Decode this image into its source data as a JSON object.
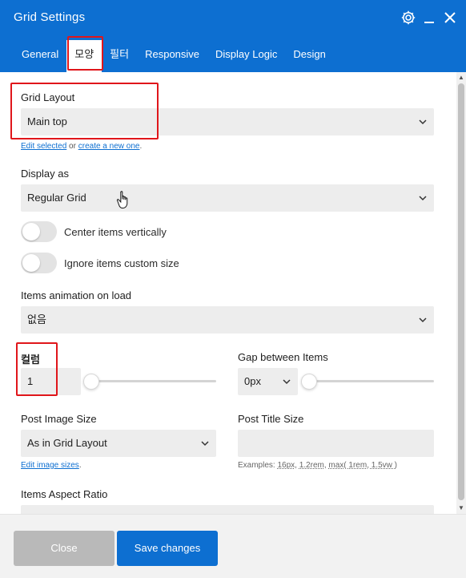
{
  "window": {
    "title": "Grid Settings",
    "icons": [
      "gear-icon",
      "minimize-icon",
      "close-icon"
    ]
  },
  "tabs": [
    {
      "label": "General",
      "active": false
    },
    {
      "label": "모양",
      "active": true
    },
    {
      "label": "필터",
      "active": false
    },
    {
      "label": "Responsive",
      "active": false
    },
    {
      "label": "Display Logic",
      "active": false
    },
    {
      "label": "Design",
      "active": false
    }
  ],
  "grid_layout": {
    "label": "Grid Layout",
    "value": "Main top",
    "link_edit": "Edit selected",
    "link_sep": "or",
    "link_create": "create a new one",
    "link_end": "."
  },
  "display_as": {
    "label": "Display as",
    "value": "Regular Grid"
  },
  "toggles": [
    {
      "label": "Center items vertically",
      "on": false
    },
    {
      "label": "Ignore items custom size",
      "on": false
    }
  ],
  "animation": {
    "label": "Items animation on load",
    "value": "없음"
  },
  "columns": {
    "label": "컬럼",
    "value": "1"
  },
  "gap": {
    "label": "Gap between Items",
    "value": "0px"
  },
  "post_image_size": {
    "label": "Post Image Size",
    "value": "As in Grid Layout",
    "link": "Edit image sizes",
    "link_end": "."
  },
  "post_title_size": {
    "label": "Post Title Size",
    "value": "",
    "hint_prefix": "Examples:",
    "hint_ex1": "16px",
    "hint_ex2": "1.2rem",
    "hint_ex3": "max( 1rem, 1.5vw )"
  },
  "aspect_ratio": {
    "label": "Items Aspect Ratio"
  },
  "footer": {
    "close_label": "Close",
    "save_label": "Save changes"
  },
  "colors": {
    "accent": "#0d6fd1",
    "highlight": "#e0161b"
  }
}
